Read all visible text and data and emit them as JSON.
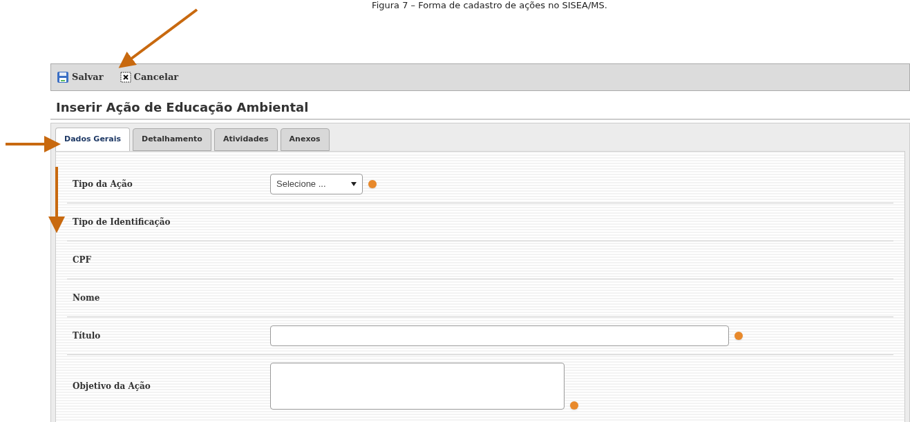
{
  "caption": "Figura 7 – Forma de cadastro de ações no SISEA/MS.",
  "toolbar": [
    {
      "label": "Salvar",
      "kind": "save"
    },
    {
      "label": "Cancelar",
      "kind": "cancel"
    }
  ],
  "title": "Inserir Ação de Educação Ambiental",
  "tabs": [
    {
      "label": "Dados Gerais",
      "selected": true
    },
    {
      "label": "Detalhamento",
      "selected": false
    },
    {
      "label": "Atividades",
      "selected": false
    },
    {
      "label": "Anexos",
      "selected": false
    }
  ],
  "fields": [
    {
      "label": "Tipo da Ação",
      "kind": "select",
      "value": "Selecione ...",
      "required": true
    },
    {
      "label": "Tipo de Identificação",
      "kind": "none"
    },
    {
      "label": "CPF",
      "kind": "none"
    },
    {
      "label": "Nome",
      "kind": "none"
    },
    {
      "label": "Título",
      "kind": "text",
      "required": true
    },
    {
      "label": "Objetivo da Ação",
      "kind": "textarea",
      "required": true
    }
  ]
}
